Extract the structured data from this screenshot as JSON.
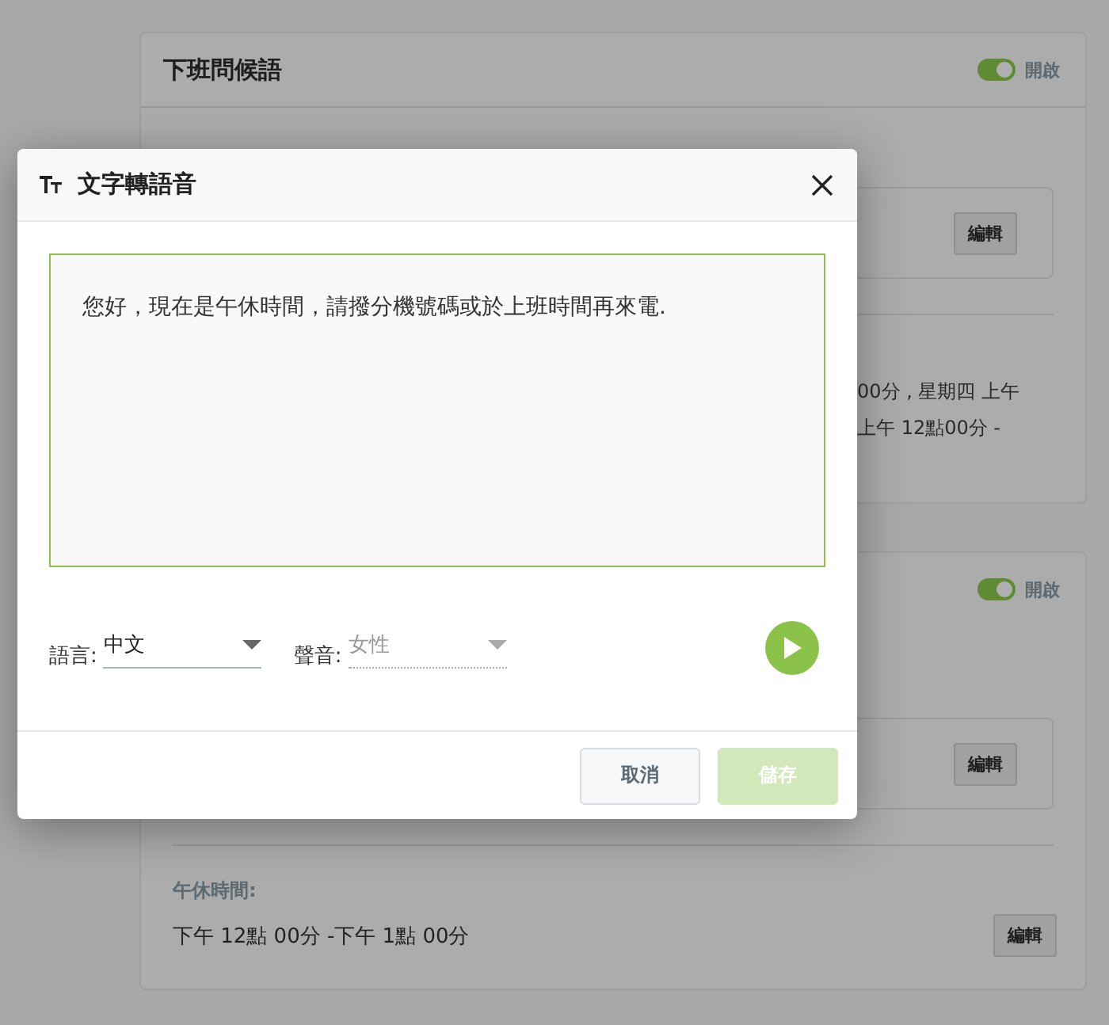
{
  "background_panels": [
    {
      "title": "下班問候語",
      "toggle": {
        "on": true,
        "label": "開啟"
      },
      "edit_button": "編輯",
      "schedule_lines": [
        "00分 , 星期四 上午",
        "上午 12點00分 -"
      ]
    },
    {
      "toggle": {
        "on": true,
        "label": "開啟"
      },
      "edit_button": "編輯",
      "lunch_label": "午休時間:",
      "lunch_time": "下午 12點 00分 -下午 1點 00分",
      "lunch_edit_button": "編輯"
    }
  ],
  "dialog": {
    "title": "文字轉語音",
    "message": "您好，現在是午休時間，請撥分機號碼或於上班時間再來電.",
    "fields": [
      {
        "label": "語言:",
        "value": "中文",
        "disabled": false
      },
      {
        "label": "聲音:",
        "value": "女性",
        "disabled": true
      }
    ],
    "buttons": [
      {
        "label": "取消",
        "kind": "secondary",
        "disabled": false
      },
      {
        "label": "儲存",
        "kind": "primary",
        "disabled": true
      }
    ]
  }
}
